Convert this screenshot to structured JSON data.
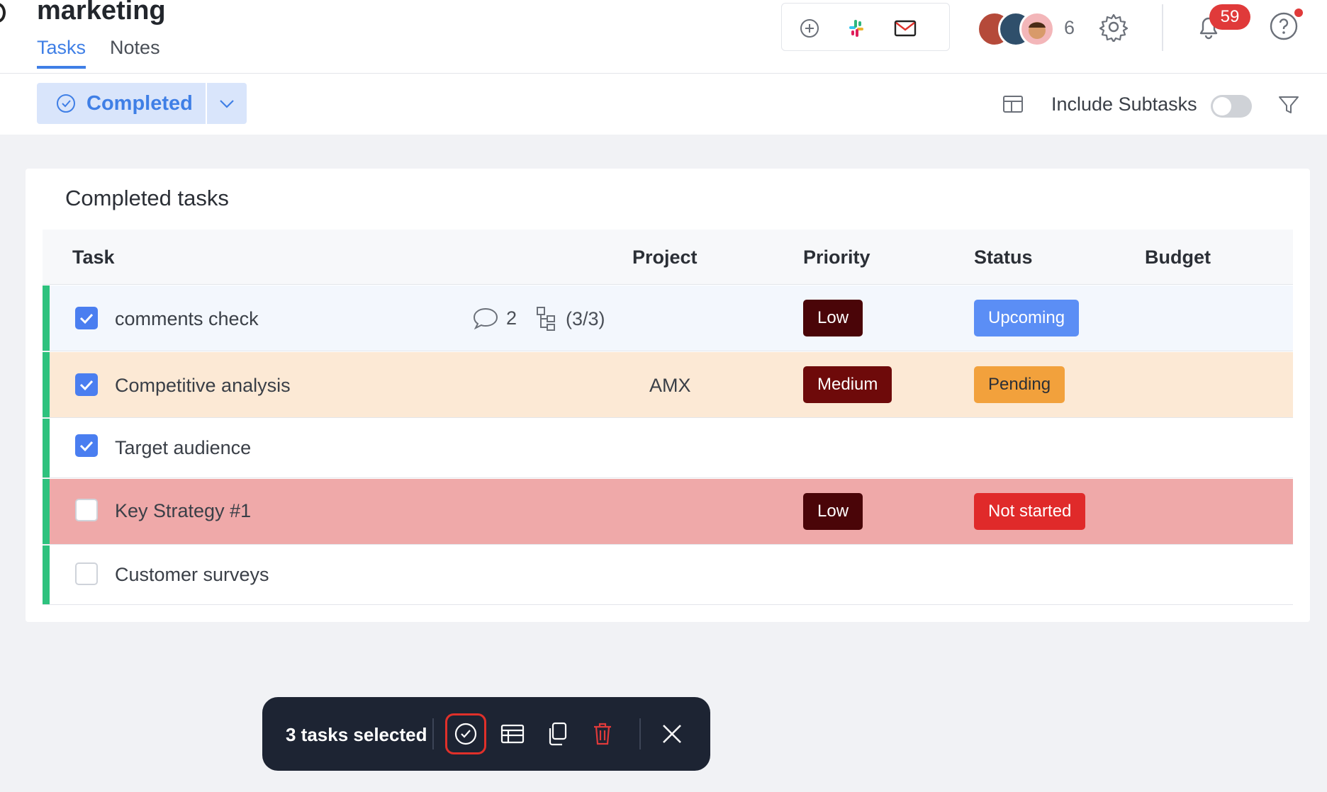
{
  "header": {
    "title": "marketing",
    "tabs": [
      {
        "label": "Tasks",
        "active": true
      },
      {
        "label": "Notes",
        "active": false
      }
    ],
    "integrations": [
      "add-circle-icon",
      "slack-icon",
      "mail-icon"
    ],
    "members_count": "6",
    "notifications_count": "59"
  },
  "toolbar": {
    "filter_label": "Completed",
    "include_subtasks_label": "Include Subtasks",
    "include_subtasks_on": false
  },
  "card": {
    "title": "Completed tasks",
    "columns": [
      "Task",
      "Project",
      "Priority",
      "Status",
      "Budget"
    ],
    "rows": [
      {
        "name": "comments check",
        "checked": true,
        "comments": "2",
        "subtasks": "(3/3)",
        "project": "",
        "priority": "Low",
        "status": "Upcoming",
        "bg": "#f3f7fd"
      },
      {
        "name": "Competitive analysis",
        "checked": true,
        "comments": "",
        "subtasks": "",
        "project": "AMX",
        "priority": "Medium",
        "status": "Pending",
        "bg": "#fce9d5"
      },
      {
        "name": "Target audience",
        "checked": true,
        "comments": "",
        "subtasks": "",
        "project": "",
        "priority": "",
        "status": "",
        "bg": "#ffffff"
      },
      {
        "name": "Key Strategy #1",
        "checked": false,
        "comments": "",
        "subtasks": "",
        "project": "",
        "priority": "Low",
        "status": "Not started",
        "bg": "#efa9a9"
      },
      {
        "name": "Customer surveys",
        "checked": false,
        "comments": "",
        "subtasks": "",
        "project": "",
        "priority": "",
        "status": "",
        "bg": "#ffffff"
      }
    ]
  },
  "colors": {
    "accent": "#3f7fe6",
    "priority_low": "#4a0508",
    "priority_medium": "#6e0a0a",
    "status_upcoming": "#5b8ef5",
    "status_pending": "#f2a13c",
    "status_not_started": "#e02a2a",
    "stripe": "#2ec27e"
  },
  "action_bar": {
    "selected_label": "3 tasks selected",
    "icons": [
      "complete-check-icon",
      "table-icon",
      "duplicate-icon",
      "trash-icon",
      "close-icon"
    ]
  }
}
